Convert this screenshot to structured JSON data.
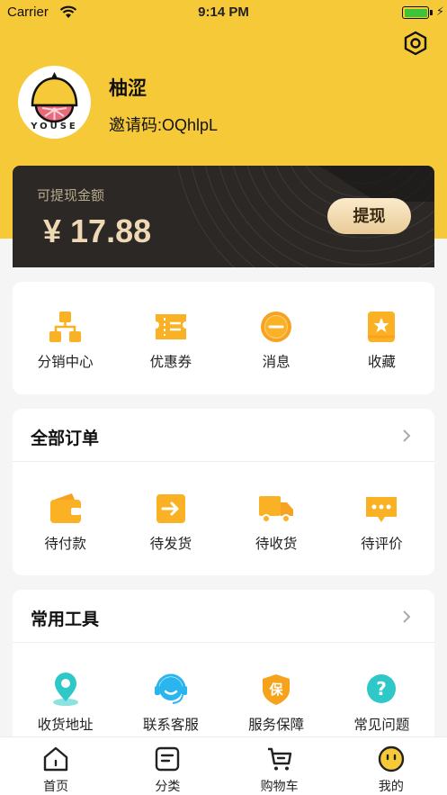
{
  "status_bar": {
    "carrier": "Carrier",
    "time": "9:14 PM"
  },
  "profile": {
    "avatar_logo_text": "YOUSE",
    "name": "柚涩",
    "invite_code": "邀请码:OQhlpL"
  },
  "balance": {
    "label": "可提现金额",
    "amount": "¥ 17.88",
    "withdraw_label": "提现"
  },
  "quick_menu": [
    {
      "label": "分销中心",
      "icon": "distribution-icon"
    },
    {
      "label": "优惠券",
      "icon": "coupon-icon"
    },
    {
      "label": "消息",
      "icon": "message-icon"
    },
    {
      "label": "收藏",
      "icon": "favorite-icon"
    }
  ],
  "orders": {
    "title": "全部订单",
    "items": [
      {
        "label": "待付款",
        "icon": "wallet-icon"
      },
      {
        "label": "待发货",
        "icon": "ship-icon"
      },
      {
        "label": "待收货",
        "icon": "truck-icon"
      },
      {
        "label": "待评价",
        "icon": "review-icon"
      }
    ]
  },
  "tools": {
    "title": "常用工具",
    "items": [
      {
        "label": "收货地址",
        "icon": "location-icon"
      },
      {
        "label": "联系客服",
        "icon": "headset-icon"
      },
      {
        "label": "服务保障",
        "icon": "shield-icon",
        "badge": "保"
      },
      {
        "label": "常见问题",
        "icon": "question-icon",
        "badge": "?"
      }
    ]
  },
  "tabbar": [
    {
      "label": "首页",
      "icon": "home-icon"
    },
    {
      "label": "分类",
      "icon": "category-icon"
    },
    {
      "label": "购物车",
      "icon": "cart-icon"
    },
    {
      "label": "我的",
      "icon": "profile-face-icon"
    }
  ],
  "colors": {
    "header_yellow": "#f6c939",
    "icon_orange": "#fbb124",
    "card_dark": "#2b2826",
    "balance_gold": "#efd9b5",
    "battery_green": "#3ac43a",
    "tool_teal": "#2ec8c8",
    "tool_blue": "#2bb5ee",
    "tool_orange": "#f7a21b"
  }
}
